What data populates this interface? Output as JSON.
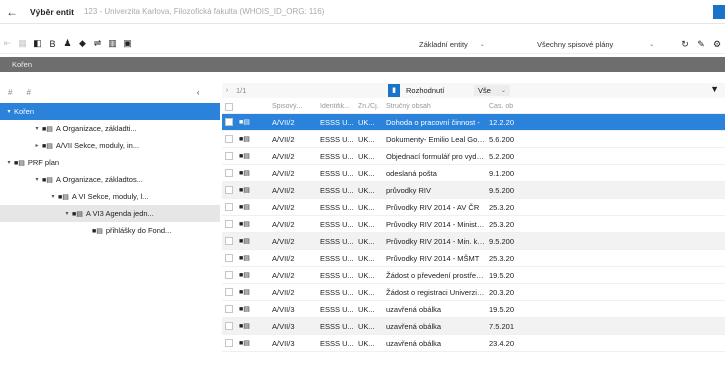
{
  "window": {
    "back_glyph": "←",
    "title": "Výběr entit",
    "subtitle": "123 - Univerzita Karlova, Filozofická fakulta (WHOIS_ID_ORG: 116)"
  },
  "toolbar": {
    "icons": [
      "first-icon",
      "prev-icon",
      "grid-icon",
      "bold-icon",
      "person-icon",
      "tag-icon",
      "filter-list-icon",
      "columns-icon",
      "save-icon"
    ],
    "entity_select": "Základní entity",
    "plan_select": "Všechny spisové plány",
    "actions": [
      "refresh-icon",
      "edit-icon",
      "settings-icon"
    ]
  },
  "path": {
    "root_label": "Kořen"
  },
  "sidebar": {
    "head_left": "#",
    "head_right": "#",
    "collapse_glyph": "‹",
    "items": [
      {
        "label": "Kořen",
        "level": 0,
        "caret": "▾",
        "state": "selected"
      },
      {
        "label": "A Organizace, základti...",
        "level": 1,
        "caret": "▾",
        "state": ""
      },
      {
        "label": "A/VII Sekce, moduly, in...",
        "level": 1,
        "caret": "▸",
        "state": ""
      },
      {
        "label": "PRF plan",
        "level": 0,
        "caret": "▾",
        "state": ""
      },
      {
        "label": "A Organizace, základtos...",
        "level": 1,
        "caret": "▾",
        "state": ""
      },
      {
        "label": "A VI Sekce, moduly, l...",
        "level": 2,
        "caret": "▾",
        "state": ""
      },
      {
        "label": "A VI3 Agenda jedn...",
        "level": 3,
        "caret": "▾",
        "state": "shaded"
      },
      {
        "label": "přihlášky do Fond...",
        "level": 4,
        "caret": "",
        "state": ""
      }
    ]
  },
  "main": {
    "page_indicator": "1/1",
    "rozhodnuti_label": "Rozhodnutí",
    "vse_label": "Vše",
    "columns": [
      "Spisový...",
      "Identifik...",
      "Zn./Čj.",
      "Stručný obsah",
      "Čas. ob"
    ],
    "rows": [
      {
        "a": "A/VII/2",
        "b": "ESSS U...",
        "c": "UK...",
        "d": "Dohoda o pracovní činnost -",
        "e": "12.2.20",
        "state": "selected"
      },
      {
        "a": "A/VII/2",
        "b": "ESSS U...",
        "c": "UK...",
        "d": "Dokumenty- Emilio Leal Gomez",
        "e": "5.6.200",
        "state": ""
      },
      {
        "a": "A/VII/2",
        "b": "ESSS U...",
        "c": "UK...",
        "d": "Objednací formulář pro vydán...",
        "e": "5.2.200",
        "state": ""
      },
      {
        "a": "A/VII/2",
        "b": "ESSS U...",
        "c": "UK...",
        "d": "odeslaná pošta",
        "e": "9.1.200",
        "state": ""
      },
      {
        "a": "A/VII/2",
        "b": "ESSS U...",
        "c": "UK...",
        "d": "průvodky RIV",
        "e": "9.5.200",
        "state": "shaded"
      },
      {
        "a": "A/VII/2",
        "b": "ESSS U...",
        "c": "UK...",
        "d": "Průvodky RIV 2014 - AV ČR",
        "e": "25.3.20",
        "state": ""
      },
      {
        "a": "A/VII/2",
        "b": "ESSS U...",
        "c": "UK...",
        "d": "Průvodky RIV 2014 - Minister...",
        "e": "25.3.20",
        "state": ""
      },
      {
        "a": "A/VII/2",
        "b": "ESSS U...",
        "c": "UK...",
        "d": "Průvodky RIV 2014 - Min. kult...",
        "e": "9.5.200",
        "state": "shaded"
      },
      {
        "a": "A/VII/2",
        "b": "ESSS U...",
        "c": "UK...",
        "d": "Průvodky RIV 2014 - MŠMT",
        "e": "25.3.20",
        "state": ""
      },
      {
        "a": "A/VII/2",
        "b": "ESSS U...",
        "c": "UK...",
        "d": "Žádost o převedení prostředk...",
        "e": "19.5.20",
        "state": ""
      },
      {
        "a": "A/VII/2",
        "b": "ESSS U...",
        "c": "UK...",
        "d": "Žádost o registraci Univerzity ...",
        "e": "20.3.20",
        "state": ""
      },
      {
        "a": "A/VII/3",
        "b": "ESSS U...",
        "c": "UK...",
        "d": "uzavřená obálka",
        "e": "19.5.20",
        "state": ""
      },
      {
        "a": "A/VII/3",
        "b": "ESSS U...",
        "c": "UK...",
        "d": "uzavřená obálka",
        "e": "7.5.201",
        "state": "shaded"
      },
      {
        "a": "A/VII/3",
        "b": "ESSS U...",
        "c": "UK...",
        "d": "uzavřená obálka",
        "e": "23.4.20",
        "state": ""
      }
    ]
  }
}
